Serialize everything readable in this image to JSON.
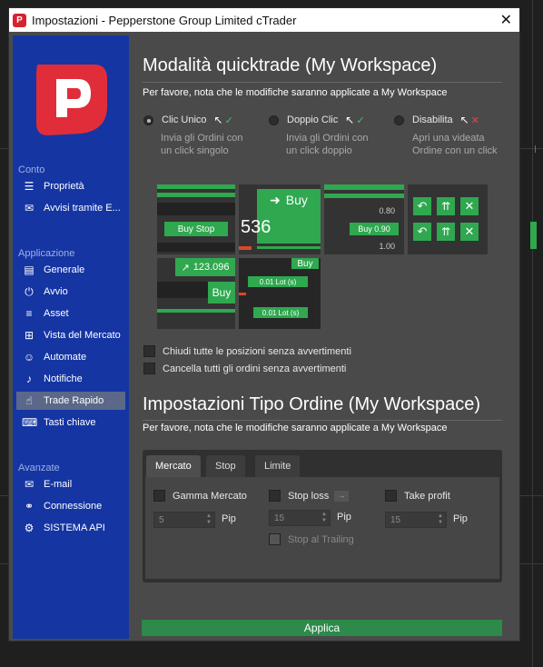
{
  "window": {
    "title": "Impostazioni - Pepperstone Group Limited cTrader",
    "app_icon": "ctrader-icon",
    "close": "✕"
  },
  "sidebar": {
    "sections": [
      {
        "title": "Conto",
        "items": [
          {
            "label": "Proprietà",
            "icon": "sliders-icon"
          },
          {
            "label": "Avvisi tramite E...",
            "icon": "mail-icon"
          }
        ]
      },
      {
        "title": "Applicazione",
        "items": [
          {
            "label": "Generale",
            "icon": "window-icon"
          },
          {
            "label": "Avvio",
            "icon": "power-icon"
          },
          {
            "label": "Asset",
            "icon": "list-icon"
          },
          {
            "label": "Vista del Mercato",
            "icon": "grid-icon"
          },
          {
            "label": "Automate",
            "icon": "robot-icon"
          },
          {
            "label": "Notifiche",
            "icon": "bell-icon"
          },
          {
            "label": "Trade Rapido",
            "icon": "hand-icon"
          },
          {
            "label": "Tasti chiave",
            "icon": "keyboard-icon"
          }
        ]
      },
      {
        "title": "Avanzate",
        "items": [
          {
            "label": "E-mail",
            "icon": "mail-icon"
          },
          {
            "label": "Connessione",
            "icon": "connection-icon"
          },
          {
            "label": "SISTEMA API",
            "icon": "api-icon"
          }
        ]
      }
    ]
  },
  "quicktrade": {
    "title": "Modalità quicktrade (My Workspace)",
    "note": "Per favore, nota che le modifiche saranno applicate a My Workspace",
    "options": [
      {
        "label": "Clic Unico",
        "desc": "Invia gli Ordini con un click singolo",
        "selected": true,
        "badge": "✓"
      },
      {
        "label": "Doppio Clic",
        "desc": "Invia gli Ordini con un click doppio",
        "selected": false,
        "badge": "✓"
      },
      {
        "label": "Disabilita",
        "desc": "Apri una videata Ordine con un click",
        "selected": false,
        "badge": "✕"
      }
    ],
    "previews": {
      "buy_stop": "Buy Stop",
      "buy": "Buy",
      "price_536": "536",
      "p080": "0.80",
      "buy090": "Buy 0.90",
      "p100": "1.00",
      "price_123": "123.096",
      "buy2": "Buy",
      "buy3": "Buy",
      "lot1": "0.01 Lot (s)",
      "lot2": "0.01 Lot (s)"
    },
    "checkboxes": [
      {
        "label": "Chiudi tutte le posizioni senza avvertimenti",
        "checked": false
      },
      {
        "label": "Cancella tutti gli ordini senza avvertimenti",
        "checked": false
      }
    ]
  },
  "order_settings": {
    "title": "Impostazioni Tipo Ordine (My Workspace)",
    "note": "Per favore, nota che le modifiche saranno applicate a My Workspace",
    "tabs": [
      "Mercato",
      "Stop",
      "Limite"
    ],
    "active_tab": "Mercato",
    "gamma": {
      "label": "Gamma Mercato",
      "value": "5",
      "unit": "Pip"
    },
    "stoploss": {
      "label": "Stop loss",
      "value": "15",
      "unit": "Pip"
    },
    "takeprofit": {
      "label": "Take profit",
      "value": "15",
      "unit": "Pip"
    },
    "trailing": {
      "label": "Stop al Trailing"
    }
  },
  "apply_label": "Applica",
  "colors": {
    "accent": "#2fa84f",
    "sidebar": "#1535a3",
    "brand_red": "#d6242f"
  }
}
